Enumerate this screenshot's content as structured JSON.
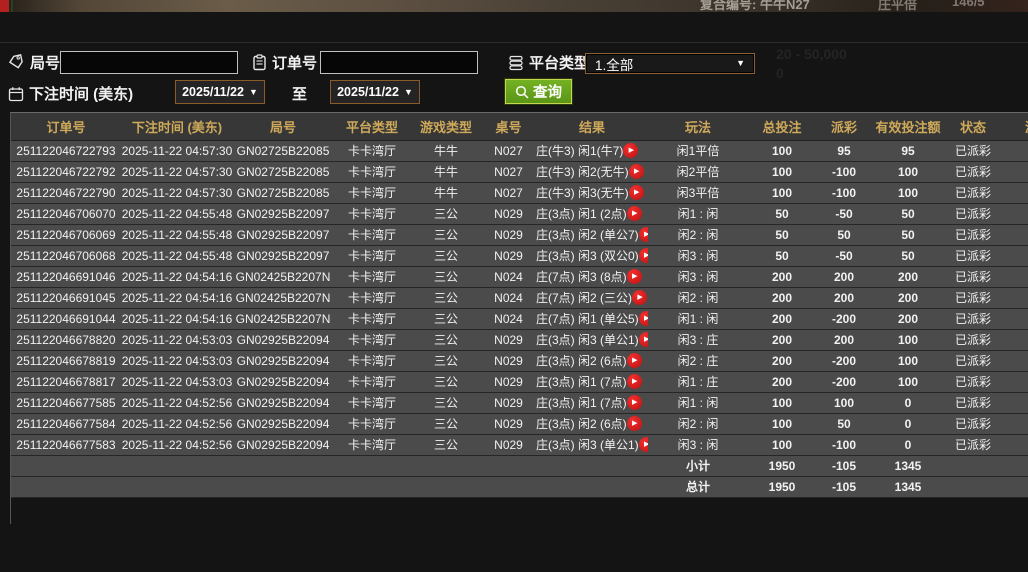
{
  "top_strip": {
    "table_fragment": "复合编号: 牛牛N27",
    "bet_fragment": "庄平倍",
    "limit_fragment": "146/5"
  },
  "background_ghost": {
    "limits": "20 - 50,000",
    "zero": "0"
  },
  "filters": {
    "game_no_label": "局号",
    "game_no_value": "",
    "order_no_label": "订单号",
    "order_no_value": "",
    "platform_type_label": "平台类型",
    "platform_type_value": "1.全部",
    "bet_time_label": "下注时间 (美东)",
    "date_from": "2025/11/22",
    "to_label": "至",
    "date_to": "2025/11/22",
    "query_label": "查询"
  },
  "table": {
    "columns": [
      "订单号",
      "下注时间 (美东)",
      "局号",
      "平台类型",
      "游戏类型",
      "桌号",
      "结果",
      "玩法",
      "总投注",
      "派彩",
      "有效投注额",
      "状态",
      "游戏"
    ],
    "rows": [
      {
        "order_no": "251122046722793",
        "bet_time": "2025-11-22 04:57:30",
        "round_no": "GN02725B22085",
        "platform": "卡卡湾厅",
        "game_type": "牛牛",
        "table_no": "N027",
        "result": "庄(牛3) 闲1(牛7)",
        "play_type": "闲1平倍",
        "total_bet": "100",
        "payout": "95",
        "payout_sign": "pos",
        "valid_bet": "95",
        "status": "已派彩"
      },
      {
        "order_no": "251122046722792",
        "bet_time": "2025-11-22 04:57:30",
        "round_no": "GN02725B22085",
        "platform": "卡卡湾厅",
        "game_type": "牛牛",
        "table_no": "N027",
        "result": "庄(牛3) 闲2(无牛)",
        "play_type": "闲2平倍",
        "total_bet": "100",
        "payout": "-100",
        "payout_sign": "neg",
        "valid_bet": "100",
        "status": "已派彩"
      },
      {
        "order_no": "251122046722790",
        "bet_time": "2025-11-22 04:57:30",
        "round_no": "GN02725B22085",
        "platform": "卡卡湾厅",
        "game_type": "牛牛",
        "table_no": "N027",
        "result": "庄(牛3) 闲3(无牛)",
        "play_type": "闲3平倍",
        "total_bet": "100",
        "payout": "-100",
        "payout_sign": "neg",
        "valid_bet": "100",
        "status": "已派彩"
      },
      {
        "order_no": "251122046706070",
        "bet_time": "2025-11-22 04:55:48",
        "round_no": "GN02925B22097",
        "platform": "卡卡湾厅",
        "game_type": "三公",
        "table_no": "N029",
        "result": "庄(3点) 闲1 (2点)",
        "play_type": "闲1 : 闲",
        "total_bet": "50",
        "payout": "-50",
        "payout_sign": "neg",
        "valid_bet": "50",
        "status": "已派彩"
      },
      {
        "order_no": "251122046706069",
        "bet_time": "2025-11-22 04:55:48",
        "round_no": "GN02925B22097",
        "platform": "卡卡湾厅",
        "game_type": "三公",
        "table_no": "N029",
        "result": "庄(3点) 闲2 (单公7)",
        "play_type": "闲2 : 闲",
        "total_bet": "50",
        "payout": "50",
        "payout_sign": "pos",
        "valid_bet": "50",
        "status": "已派彩"
      },
      {
        "order_no": "251122046706068",
        "bet_time": "2025-11-22 04:55:48",
        "round_no": "GN02925B22097",
        "platform": "卡卡湾厅",
        "game_type": "三公",
        "table_no": "N029",
        "result": "庄(3点) 闲3 (双公0)",
        "play_type": "闲3 : 闲",
        "total_bet": "50",
        "payout": "-50",
        "payout_sign": "neg",
        "valid_bet": "50",
        "status": "已派彩"
      },
      {
        "order_no": "251122046691046",
        "bet_time": "2025-11-22 04:54:16",
        "round_no": "GN02425B2207N",
        "platform": "卡卡湾厅",
        "game_type": "三公",
        "table_no": "N024",
        "result": "庄(7点) 闲3 (8点)",
        "play_type": "闲3 : 闲",
        "total_bet": "200",
        "payout": "200",
        "payout_sign": "pos",
        "valid_bet": "200",
        "status": "已派彩"
      },
      {
        "order_no": "251122046691045",
        "bet_time": "2025-11-22 04:54:16",
        "round_no": "GN02425B2207N",
        "platform": "卡卡湾厅",
        "game_type": "三公",
        "table_no": "N024",
        "result": "庄(7点) 闲2 (三公)",
        "play_type": "闲2 : 闲",
        "total_bet": "200",
        "payout": "200",
        "payout_sign": "pos",
        "valid_bet": "200",
        "status": "已派彩"
      },
      {
        "order_no": "251122046691044",
        "bet_time": "2025-11-22 04:54:16",
        "round_no": "GN02425B2207N",
        "platform": "卡卡湾厅",
        "game_type": "三公",
        "table_no": "N024",
        "result": "庄(7点) 闲1 (单公5)",
        "play_type": "闲1 : 闲",
        "total_bet": "200",
        "payout": "-200",
        "payout_sign": "neg",
        "valid_bet": "200",
        "status": "已派彩"
      },
      {
        "order_no": "251122046678820",
        "bet_time": "2025-11-22 04:53:03",
        "round_no": "GN02925B22094",
        "platform": "卡卡湾厅",
        "game_type": "三公",
        "table_no": "N029",
        "result": "庄(3点) 闲3 (单公1)",
        "play_type": "闲3 : 庄",
        "total_bet": "200",
        "payout": "200",
        "payout_sign": "pos",
        "valid_bet": "100",
        "status": "已派彩"
      },
      {
        "order_no": "251122046678819",
        "bet_time": "2025-11-22 04:53:03",
        "round_no": "GN02925B22094",
        "platform": "卡卡湾厅",
        "game_type": "三公",
        "table_no": "N029",
        "result": "庄(3点) 闲2 (6点)",
        "play_type": "闲2 : 庄",
        "total_bet": "200",
        "payout": "-200",
        "payout_sign": "neg",
        "valid_bet": "100",
        "status": "已派彩"
      },
      {
        "order_no": "251122046678817",
        "bet_time": "2025-11-22 04:53:03",
        "round_no": "GN02925B22094",
        "platform": "卡卡湾厅",
        "game_type": "三公",
        "table_no": "N029",
        "result": "庄(3点) 闲1 (7点)",
        "play_type": "闲1 : 庄",
        "total_bet": "200",
        "payout": "-200",
        "payout_sign": "neg",
        "valid_bet": "100",
        "status": "已派彩"
      },
      {
        "order_no": "251122046677585",
        "bet_time": "2025-11-22 04:52:56",
        "round_no": "GN02925B22094",
        "platform": "卡卡湾厅",
        "game_type": "三公",
        "table_no": "N029",
        "result": "庄(3点) 闲1 (7点)",
        "play_type": "闲1 : 闲",
        "total_bet": "100",
        "payout": "100",
        "payout_sign": "pos",
        "valid_bet": "0",
        "status": "已派彩"
      },
      {
        "order_no": "251122046677584",
        "bet_time": "2025-11-22 04:52:56",
        "round_no": "GN02925B22094",
        "platform": "卡卡湾厅",
        "game_type": "三公",
        "table_no": "N029",
        "result": "庄(3点) 闲2 (6点)",
        "play_type": "闲2 : 闲",
        "total_bet": "100",
        "payout": "50",
        "payout_sign": "pos",
        "valid_bet": "0",
        "status": "已派彩"
      },
      {
        "order_no": "251122046677583",
        "bet_time": "2025-11-22 04:52:56",
        "round_no": "GN02925B22094",
        "platform": "卡卡湾厅",
        "game_type": "三公",
        "table_no": "N029",
        "result": "庄(3点) 闲3 (单公1)",
        "play_type": "闲3 : 闲",
        "total_bet": "100",
        "payout": "-100",
        "payout_sign": "neg",
        "valid_bet": "0",
        "status": "已派彩"
      }
    ],
    "subtotal": {
      "label": "小计",
      "total_bet": "1950",
      "payout": "-105",
      "valid_bet": "1345"
    },
    "total": {
      "label": "总计",
      "total_bet": "1950",
      "payout": "-105",
      "valid_bet": "1345"
    }
  },
  "colors": {
    "header_gold": "#cfa95a",
    "payout_positive": "#b63232",
    "payout_negative": "#3cd43c",
    "status_green": "#2fd32f",
    "summary_yellow": "#e8e832",
    "query_green": "#6aa41e",
    "play_red": "#d51515"
  }
}
